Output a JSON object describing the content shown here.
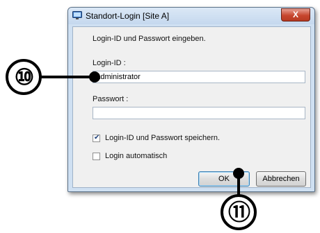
{
  "window": {
    "title": "Standort-Login [Site A]",
    "close_label": "X"
  },
  "form": {
    "instruction": "Login-ID und Passwort eingeben.",
    "login_label": "Login-ID :",
    "login_value": "Administrator",
    "password_label": "Passwort :",
    "password_value": "",
    "save_checkbox_label": "Login-ID und Passwort speichern.",
    "save_checked": true,
    "auto_checkbox_label": "Login automatisch",
    "auto_checked": false
  },
  "buttons": {
    "ok_label": "OK",
    "cancel_label": "Abbrechen"
  },
  "callouts": {
    "login_field_marker": "⑩",
    "ok_button_marker": "⑪"
  }
}
